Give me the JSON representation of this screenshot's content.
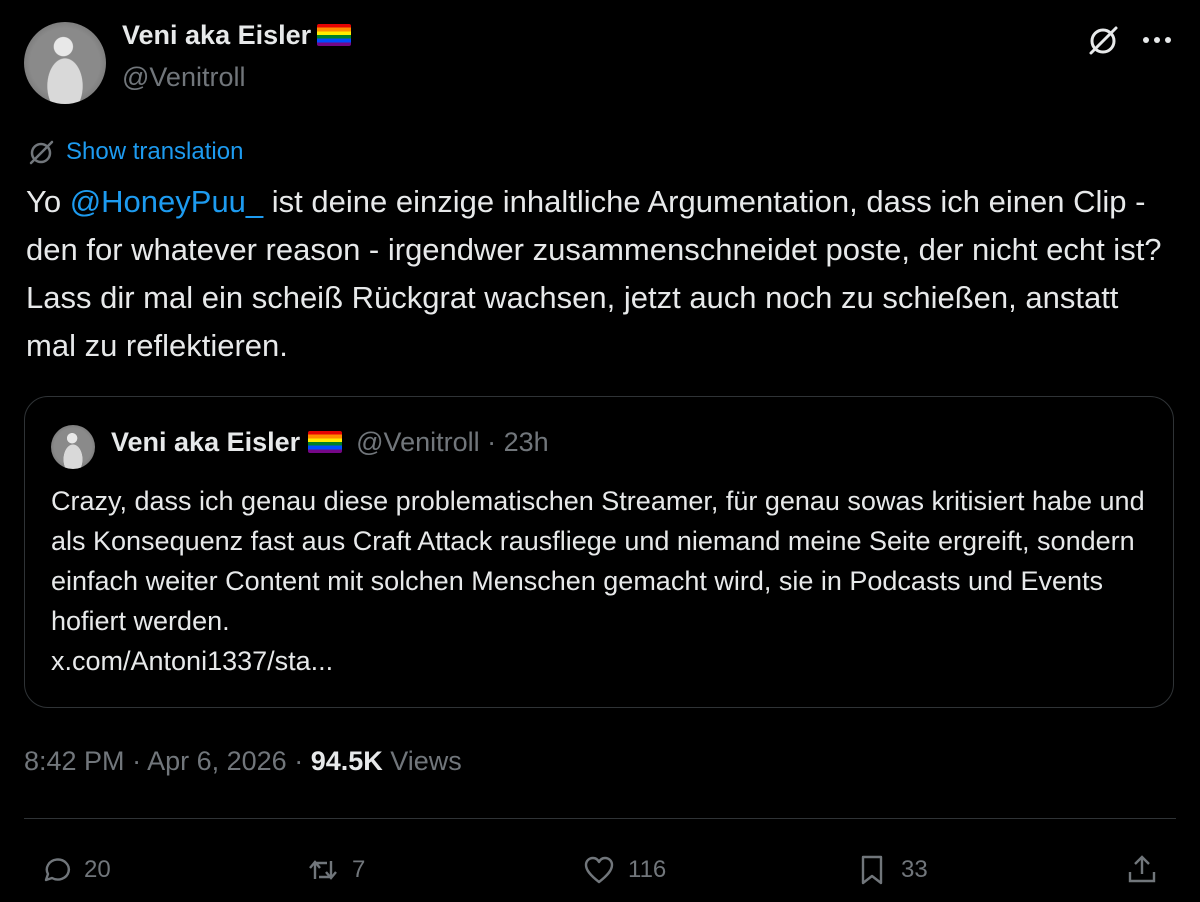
{
  "author": {
    "display_name": "Veni aka Eisler",
    "flag": "rainbow-flag",
    "handle": "@Venitroll"
  },
  "header_actions": {
    "grok_icon": "grok-icon",
    "more_icon": "more-icon"
  },
  "translation": {
    "label": "Show translation"
  },
  "tweet": {
    "text_before": "Yo ",
    "mention": "@HoneyPuu_",
    "text_after": " ist deine einzige inhaltliche Argumentation, dass ich einen Clip - den for whatever reason - irgendwer zusammenschneidet poste, der nicht echt ist? Lass dir mal ein scheiß Rückgrat wachsen, jetzt auch noch zu schießen, anstatt mal zu reflektieren."
  },
  "quote": {
    "display_name": "Veni aka Eisler",
    "handle": "@Venitroll",
    "separator": " · ",
    "time": "23h",
    "text": "Crazy, dass ich genau diese problematischen Streamer, für genau sowas kritisiert habe und als Konsequenz fast aus Craft Attack rausfliege und niemand meine Seite ergreift, sondern einfach weiter Content mit solchen Menschen gemacht wird, sie in Podcasts und Events hofiert werden.",
    "link": "x.com/Antoni1337/sta..."
  },
  "meta": {
    "time": "8:42 PM",
    "sep1": " · ",
    "date": "Apr 6, 2026",
    "sep2": " · ",
    "views_count": "94.5K",
    "views_label": " Views"
  },
  "actions": {
    "replies": "20",
    "reposts": "7",
    "likes": "116",
    "bookmarks": "33"
  },
  "colors": {
    "background": "#000000",
    "text": "#e7e9ea",
    "secondary": "#71767b",
    "accent": "#1d9bf0",
    "border": "#2f3336"
  }
}
